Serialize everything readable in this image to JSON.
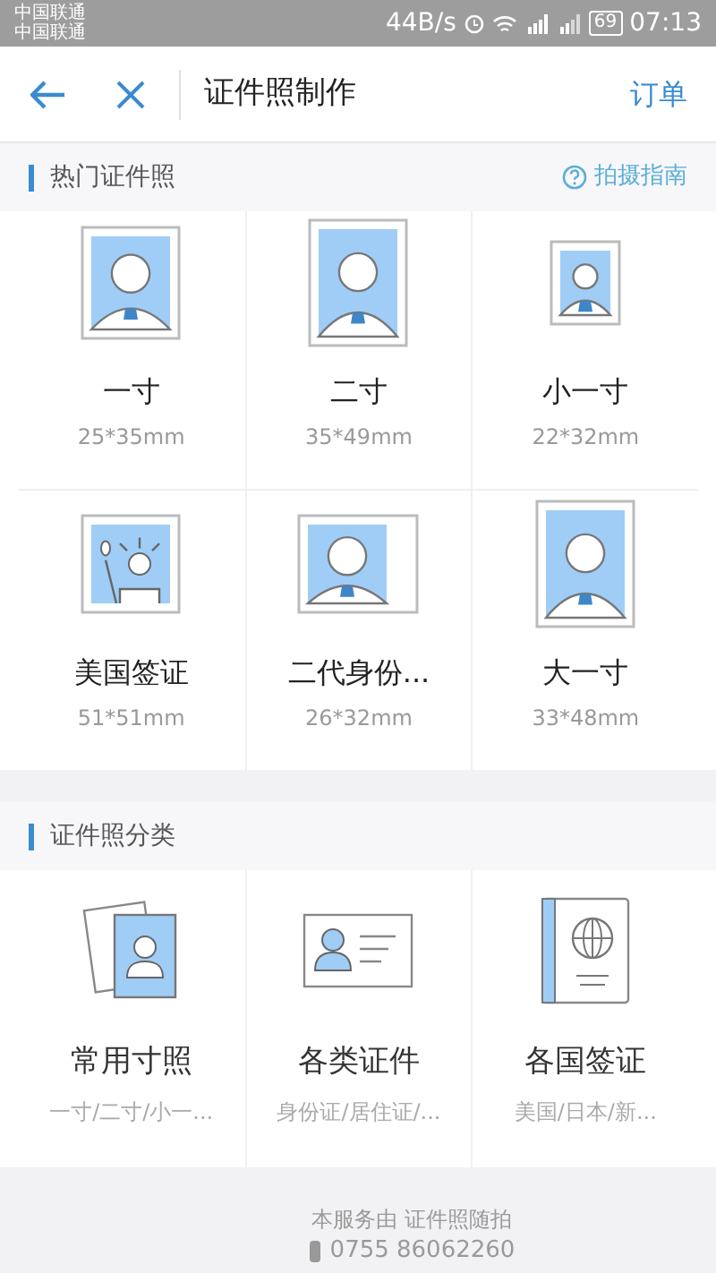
{
  "status_bar": {
    "carriers": [
      "中国联通",
      "中国联通"
    ],
    "speed": "44B/s",
    "battery": "69",
    "time": "07:13"
  },
  "header": {
    "title": "证件照制作",
    "action": "订单"
  },
  "hot_section": {
    "title": "热门证件照",
    "guide": "拍摄指南",
    "items": [
      {
        "name": "一寸",
        "size": "25*35mm",
        "kind": "portrait"
      },
      {
        "name": "二寸",
        "size": "35*49mm",
        "kind": "portrait"
      },
      {
        "name": "小一寸",
        "size": "22*32mm",
        "kind": "portrait"
      },
      {
        "name": "美国签证",
        "size": "51*51mm",
        "kind": "statue"
      },
      {
        "name": "二代身份...",
        "size": "26*32mm",
        "kind": "portrait"
      },
      {
        "name": "大一寸",
        "size": "33*48mm",
        "kind": "portrait"
      }
    ]
  },
  "category_section": {
    "title": "证件照分类",
    "items": [
      {
        "name": "常用寸照",
        "desc": "一寸/二寸/小一...",
        "kind": "photos"
      },
      {
        "name": "各类证件",
        "desc": "身份证/居住证/...",
        "kind": "card"
      },
      {
        "name": "各国签证",
        "desc": "美国/日本/新...",
        "kind": "passport"
      }
    ]
  },
  "footer": {
    "provider": "本服务由 证件照随拍",
    "phone": "0755 86062260"
  }
}
